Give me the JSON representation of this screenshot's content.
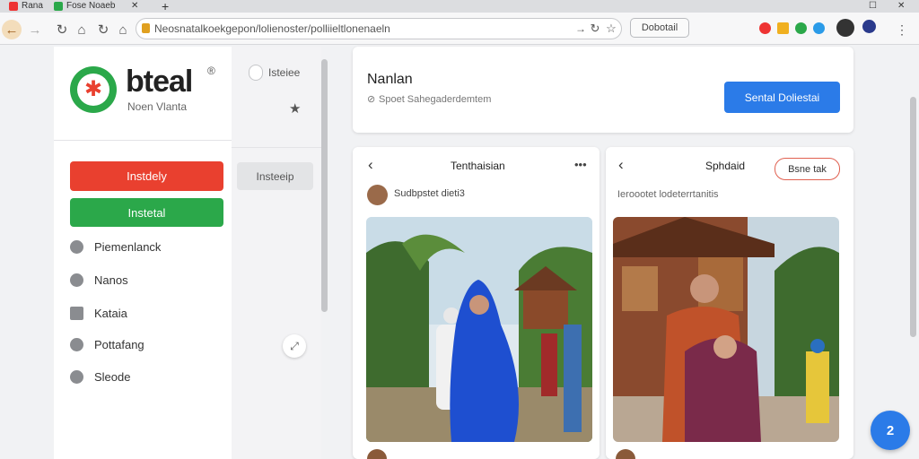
{
  "browser": {
    "tabs": [
      {
        "label": "Rana"
      },
      {
        "label": "Fose Noaeb"
      }
    ],
    "new_tab": "+",
    "address": "Neosnatalkoekgepon/lolienoster/polliieltlonenaeln",
    "toolbar_button": "Dobotail"
  },
  "sidebar": {
    "logo_title": "bteal",
    "logo_mark": "®",
    "logo_subtitle": "Noen Vlanta",
    "buttons": {
      "primary": "Instdely",
      "secondary": "Instetal"
    },
    "items": [
      {
        "label": "Piemenlanck"
      },
      {
        "label": "Nanos"
      },
      {
        "label": "Kataia"
      },
      {
        "label": "Pottafang"
      },
      {
        "label": "Sleode"
      }
    ]
  },
  "subpanel": {
    "toggle_label": "Isteiee",
    "chip": "Insteeip"
  },
  "header": {
    "title": "Nanlan",
    "subtitle": "Spoet Sahegaderdemtem",
    "action": "Sental Doliestai"
  },
  "posts": [
    {
      "title": "Tenthaisian",
      "author": "Sudbpstet dieti3",
      "image_label": "Photo: woman in blue hijab and man in white kufi among palm trees"
    },
    {
      "title": "Sphdaid",
      "button": "Bsne tak",
      "caption": "Ieroootet lodeterrtanitis",
      "image_label": "Photo: man and woman in batik outfits before wooden house"
    }
  ],
  "fab": {
    "label": "2"
  },
  "colors": {
    "red": "#e9402f",
    "green": "#2ba84a",
    "blue": "#2b7be8"
  }
}
